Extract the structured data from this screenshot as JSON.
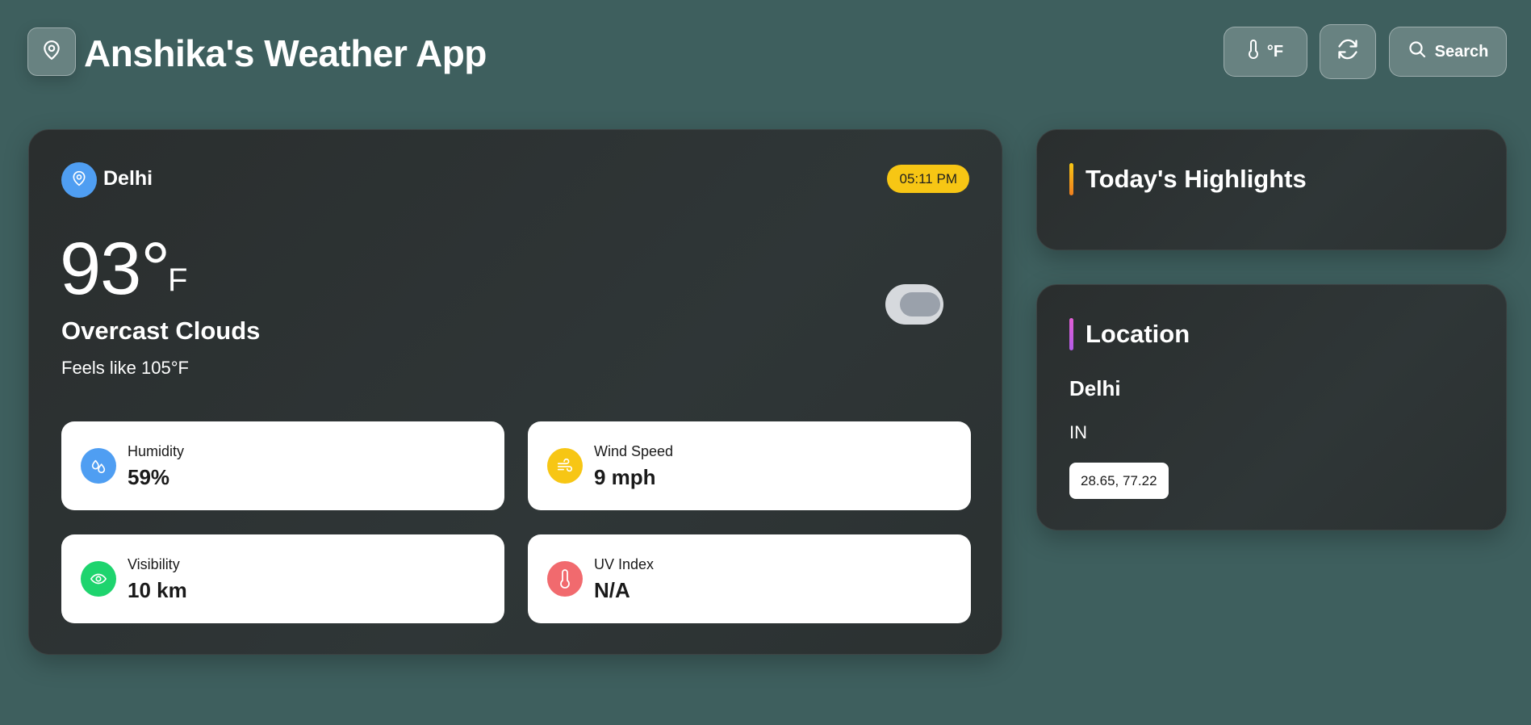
{
  "app": {
    "title": "Anshika's Weather App",
    "logo_icon": "map-pin-icon"
  },
  "header": {
    "unit_button": {
      "icon": "thermometer-icon",
      "label": "°F"
    },
    "refresh_button": {
      "icon": "refresh-icon"
    },
    "search_button": {
      "icon": "search-icon",
      "label": "Search"
    }
  },
  "current": {
    "city": "Delhi",
    "city_icon": "map-pin-icon",
    "time": "05:11 PM",
    "temperature": "93°",
    "unit": "F",
    "condition": "Overcast Clouds",
    "feels_like": "Feels like 105°F",
    "toggle_on": false
  },
  "stats": [
    {
      "label": "Humidity",
      "value": "59%",
      "icon": "droplets-icon",
      "color": "#4f9ef2"
    },
    {
      "label": "Wind Speed",
      "value": "9 mph",
      "icon": "wind-icon",
      "color": "#f7c614"
    },
    {
      "label": "Visibility",
      "value": "10 km",
      "icon": "eye-icon",
      "color": "#1ed46e"
    },
    {
      "label": "UV Index",
      "value": "N/A",
      "icon": "thermometer-icon",
      "color": "#f16a6e"
    }
  ],
  "highlights": {
    "title": "Today's Highlights",
    "accent": "#f7a11a"
  },
  "location": {
    "title": "Location",
    "accent": "#d45ee0",
    "city": "Delhi",
    "country": "IN",
    "coords": "28.65, 77.22"
  }
}
